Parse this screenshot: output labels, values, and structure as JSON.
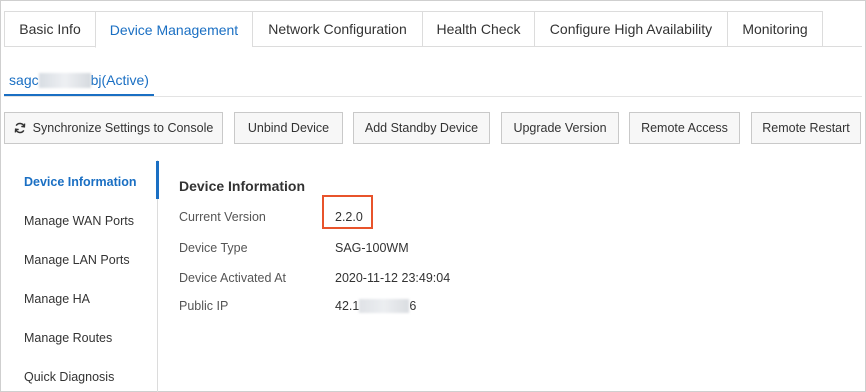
{
  "tabs": [
    {
      "label": "Basic Info",
      "active": false
    },
    {
      "label": "Device Management",
      "active": true
    },
    {
      "label": "Network Configuration",
      "active": false
    },
    {
      "label": "Health Check",
      "active": false
    },
    {
      "label": "Configure High Availability",
      "active": false
    },
    {
      "label": "Monitoring",
      "active": false
    }
  ],
  "device_tab": {
    "prefix": "sagc",
    "suffix": "bj(Active)"
  },
  "toolbar": {
    "sync_label": "Synchronize Settings to Console",
    "sync_icon": "refresh-icon",
    "unbind_label": "Unbind Device",
    "standby_label": "Add Standby Device",
    "upgrade_label": "Upgrade Version",
    "remote_access_label": "Remote Access",
    "remote_restart_label": "Remote Restart"
  },
  "side_nav": [
    {
      "label": "Device Information",
      "active": true
    },
    {
      "label": "Manage WAN Ports",
      "active": false
    },
    {
      "label": "Manage LAN Ports",
      "active": false
    },
    {
      "label": "Manage HA",
      "active": false
    },
    {
      "label": "Manage Routes",
      "active": false
    },
    {
      "label": "Quick Diagnosis",
      "active": false
    }
  ],
  "device_info": {
    "title": "Device Information",
    "current_version_label": "Current Version",
    "current_version": "2.2.0",
    "device_type_label": "Device Type",
    "device_type": "SAG-100WM",
    "activated_label": "Device Activated At",
    "activated_at": "2020-11-12 23:49:04",
    "public_ip_label": "Public IP",
    "public_ip_prefix": "42.1",
    "public_ip_suffix": "6"
  },
  "colors": {
    "accent": "#1a6fc3",
    "highlight": "#e8532b",
    "border": "#dcdcdc",
    "button_bg": "#f7f7f7"
  }
}
